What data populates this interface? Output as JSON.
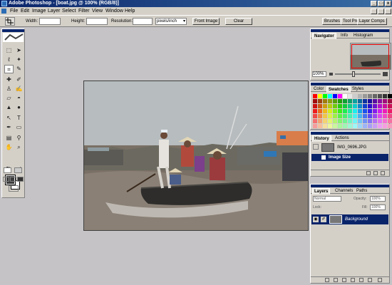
{
  "app": {
    "title": "Adobe Photoshop - [boat.jpg @ 100% (RGB/8)]",
    "window_buttons": [
      "_",
      "□",
      "x"
    ]
  },
  "menubar": {
    "items": [
      "File",
      "Edit",
      "Image",
      "Layer",
      "Select",
      "Filter",
      "View",
      "Window",
      "Help"
    ]
  },
  "options": {
    "width_label": "Width:",
    "width_value": "",
    "height_label": "Height:",
    "height_value": "",
    "resolution_label": "Resolution:",
    "resolution_value": "",
    "unit_select": "pixels/inch",
    "front_image": "Front Image",
    "clear": "Clear",
    "well_tabs": [
      "Brushes",
      "Tool Pre",
      "Layer Comps"
    ]
  },
  "toolbox": {
    "tools": [
      "marquee-icon",
      "move-icon",
      "lasso-icon",
      "magic-wand-icon",
      "crop-icon",
      "slice-icon",
      "healing-brush-icon",
      "brush-icon",
      "clone-stamp-icon",
      "history-brush-icon",
      "eraser-icon",
      "paint-bucket-icon",
      "blur-icon",
      "dodge-icon",
      "path-select-icon",
      "type-icon",
      "pen-icon",
      "shape-icon",
      "notes-icon",
      "eyedropper-icon",
      "hand-icon",
      "zoom-icon"
    ],
    "colors": {
      "foreground": "#3c3c3c",
      "background": "#ffffff"
    }
  },
  "navigator_panel": {
    "tabs": [
      "Navigator",
      "Info",
      "Histogram"
    ],
    "zoom": "100%"
  },
  "color_panel": {
    "tabs": [
      "Color",
      "Swatches",
      "Styles"
    ]
  },
  "history_panel": {
    "tabs": [
      "History",
      "Actions"
    ],
    "snapshot": "IMG_0696.JPG",
    "states": [
      "Image Size"
    ]
  },
  "layers_panel": {
    "tabs": [
      "Layers",
      "Channels",
      "Paths"
    ],
    "blend_mode": "Normal",
    "opacity_label": "Opacity:",
    "opacity": "100%",
    "lock_label": "Lock:",
    "fill_label": "Fill:",
    "fill": "100%",
    "layers": [
      "Background"
    ]
  },
  "colors": {
    "titlebar": "#0a246a",
    "chrome": "#d4d0c8",
    "workspace": "#c6c3c6",
    "selection": "#0a246a"
  }
}
